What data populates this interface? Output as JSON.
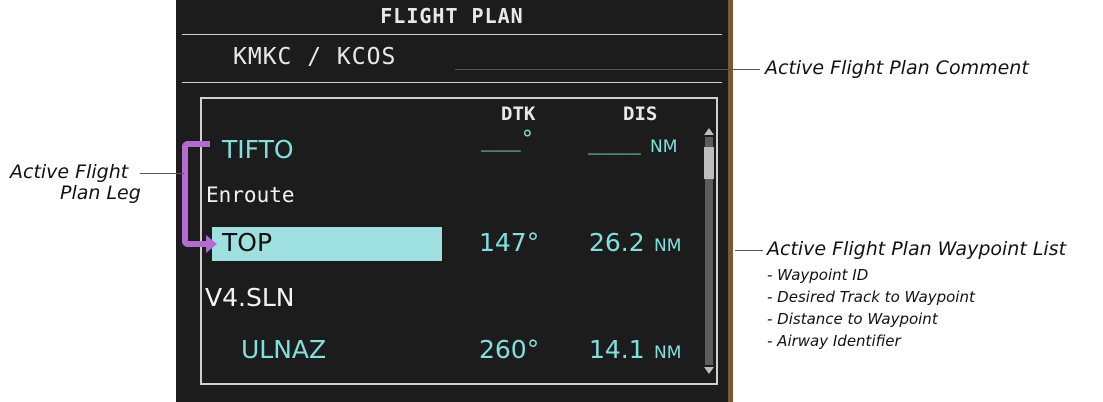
{
  "header": {
    "title": "FLIGHT PLAN"
  },
  "comment": "KMKC / KCOS",
  "columns": {
    "dtk": "DTK",
    "dis": "DIS"
  },
  "waypoints": [
    {
      "id": "TIFTO",
      "dtk": "___°",
      "dis": "____",
      "unit": "NM"
    },
    {
      "id": "TOP",
      "dtk": "147°",
      "dis": "26.2",
      "unit": "NM"
    },
    {
      "id": "ULNAZ",
      "dtk": "260°",
      "dis": "14.1",
      "unit": "NM"
    }
  ],
  "airways": {
    "enroute": "Enroute",
    "v4sln": "V4.SLN"
  },
  "callouts": {
    "comment": "Active Flight Plan Comment",
    "leg_line1": "Active Flight",
    "leg_line2": "Plan Leg",
    "list_title": "Active Flight Plan Waypoint List",
    "list_items": [
      "- Waypoint ID",
      "- Desired Track to Waypoint",
      "- Distance to Waypoint",
      "- Airway Identifier"
    ]
  },
  "colors": {
    "panel": "#1c1c1c",
    "cyan": "#7fe0e0",
    "selection": "#9ee0e0",
    "leg": "#b46ad0",
    "bezel": "#7a5a32"
  }
}
